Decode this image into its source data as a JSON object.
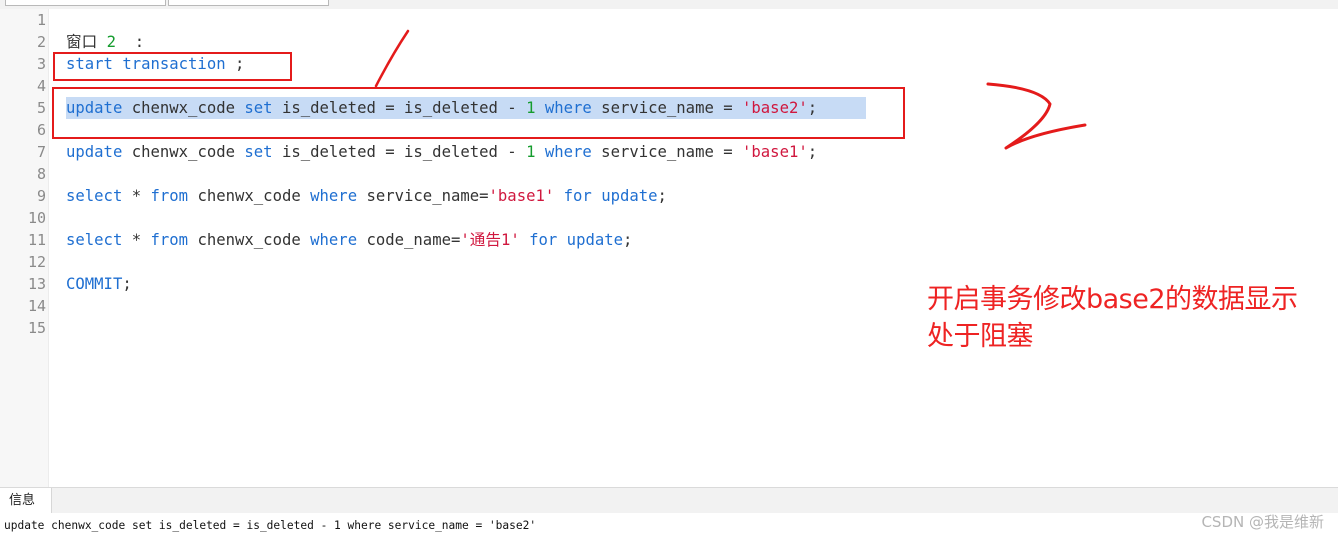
{
  "editor": {
    "line_numbers": [
      "1",
      "2",
      "3",
      "4",
      "5",
      "6",
      "7",
      "8",
      "9",
      "10",
      "11",
      "12",
      "13",
      "14",
      "15"
    ],
    "lines": [
      {
        "line": 2,
        "tokens": [
          {
            "t": "窗口 ",
            "c": "plain"
          },
          {
            "t": "2",
            "c": "num"
          },
          {
            "t": "  :",
            "c": "plain"
          }
        ]
      },
      {
        "line": 3,
        "tokens": [
          {
            "t": "start transaction",
            "c": "kw"
          },
          {
            "t": " ;",
            "c": "plain"
          }
        ]
      },
      {
        "line": 5,
        "tokens": [
          {
            "t": "update",
            "c": "kw"
          },
          {
            "t": " chenwx_code ",
            "c": "plain"
          },
          {
            "t": "set",
            "c": "kw"
          },
          {
            "t": " is_deleted = is_deleted - ",
            "c": "plain"
          },
          {
            "t": "1",
            "c": "num"
          },
          {
            "t": " ",
            "c": "plain"
          },
          {
            "t": "where",
            "c": "kw"
          },
          {
            "t": " service_name = ",
            "c": "plain"
          },
          {
            "t": "'base2'",
            "c": "str"
          },
          {
            "t": ";",
            "c": "plain"
          }
        ]
      },
      {
        "line": 7,
        "tokens": [
          {
            "t": "update",
            "c": "kw"
          },
          {
            "t": " chenwx_code ",
            "c": "plain"
          },
          {
            "t": "set",
            "c": "kw"
          },
          {
            "t": " is_deleted = is_deleted - ",
            "c": "plain"
          },
          {
            "t": "1",
            "c": "num"
          },
          {
            "t": " ",
            "c": "plain"
          },
          {
            "t": "where",
            "c": "kw"
          },
          {
            "t": " service_name = ",
            "c": "plain"
          },
          {
            "t": "'base1'",
            "c": "str"
          },
          {
            "t": ";",
            "c": "plain"
          }
        ]
      },
      {
        "line": 9,
        "tokens": [
          {
            "t": "select",
            "c": "kw"
          },
          {
            "t": " * ",
            "c": "plain"
          },
          {
            "t": "from",
            "c": "kw"
          },
          {
            "t": " chenwx_code ",
            "c": "plain"
          },
          {
            "t": "where",
            "c": "kw"
          },
          {
            "t": " service_name=",
            "c": "plain"
          },
          {
            "t": "'base1'",
            "c": "str"
          },
          {
            "t": " ",
            "c": "plain"
          },
          {
            "t": "for update",
            "c": "kw"
          },
          {
            "t": ";",
            "c": "plain"
          }
        ]
      },
      {
        "line": 11,
        "tokens": [
          {
            "t": "select",
            "c": "kw"
          },
          {
            "t": " * ",
            "c": "plain"
          },
          {
            "t": "from",
            "c": "kw"
          },
          {
            "t": " chenwx_code ",
            "c": "plain"
          },
          {
            "t": "where",
            "c": "kw"
          },
          {
            "t": " code_name=",
            "c": "plain"
          },
          {
            "t": "'通告1'",
            "c": "str"
          },
          {
            "t": " ",
            "c": "plain"
          },
          {
            "t": "for update",
            "c": "kw"
          },
          {
            "t": ";",
            "c": "plain"
          }
        ]
      },
      {
        "line": 13,
        "tokens": [
          {
            "t": "COMMIT",
            "c": "kw"
          },
          {
            "t": ";",
            "c": "plain"
          }
        ]
      }
    ],
    "selected_line": 5
  },
  "annotation": {
    "line1": "开启事务修改base2的数据显示",
    "line2": "处于阻塞",
    "color": "#ee2323"
  },
  "panel": {
    "tab_label": "信息",
    "result_text": "update chenwx_code set is_deleted = is_deleted - 1 where service_name = 'base2'"
  },
  "watermark": "CSDN @我是维新",
  "colors": {
    "keyword": "#1f6fd1",
    "number": "#159c2e",
    "string": "#d0173e",
    "selection": "#c7dbf5",
    "highlight_box": "#e41b1b"
  }
}
